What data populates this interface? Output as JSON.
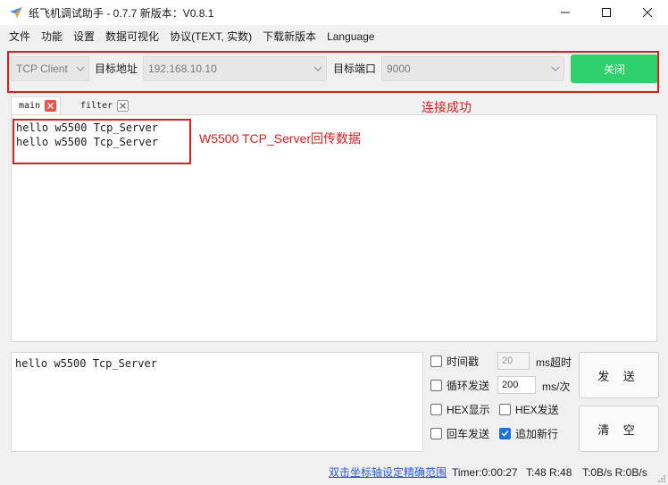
{
  "window": {
    "title": "纸飞机调试助手 - 0.7.7 新版本：V0.8.1"
  },
  "menu": [
    "文件",
    "功能",
    "设置",
    "数据可视化",
    "协议(TEXT, 实数)",
    "下载新版本",
    "Language"
  ],
  "connection": {
    "protocol": "TCP Client",
    "address_label": "目标地址",
    "address_value": "192.168.10.10",
    "port_label": "目标端口",
    "port_value": "9000",
    "close_label": "关闭",
    "status_note": "连接成功"
  },
  "tabs": [
    {
      "label": "main"
    },
    {
      "label": "filter"
    }
  ],
  "receive": {
    "lines": [
      "hello w5500 Tcp_Server",
      "hello w5500 Tcp_Server"
    ],
    "annotation": "W5500 TCP_Server回传数据"
  },
  "send": {
    "text": "hello w5500 Tcp_Server",
    "send_label": "发 送",
    "clear_label": "清 空"
  },
  "options": {
    "timestamp": {
      "label": "时间戳",
      "checked": false
    },
    "timeout_value": "20",
    "timeout_unit": "ms超时",
    "loop": {
      "label": "循环发送",
      "checked": false
    },
    "interval_value": "200",
    "interval_unit": "ms/次",
    "hex_display": {
      "label": "HEX显示",
      "checked": false
    },
    "hex_send": {
      "label": "HEX发送",
      "checked": false
    },
    "enter_send": {
      "label": "回车发送",
      "checked": false
    },
    "append_newline": {
      "label": "追加新行",
      "checked": true
    }
  },
  "statusbar": {
    "link": "双击坐标轴设定精确范围",
    "timer": "Timer:0:00:27",
    "tx_rx": "T:48 R:48",
    "rate": "T:0B/s R:0B/s"
  },
  "colors": {
    "accent_green": "#2fd26a",
    "annotation_red": "#d62020",
    "checkbox_blue": "#1a73d9",
    "link_blue": "#2a56d8"
  }
}
